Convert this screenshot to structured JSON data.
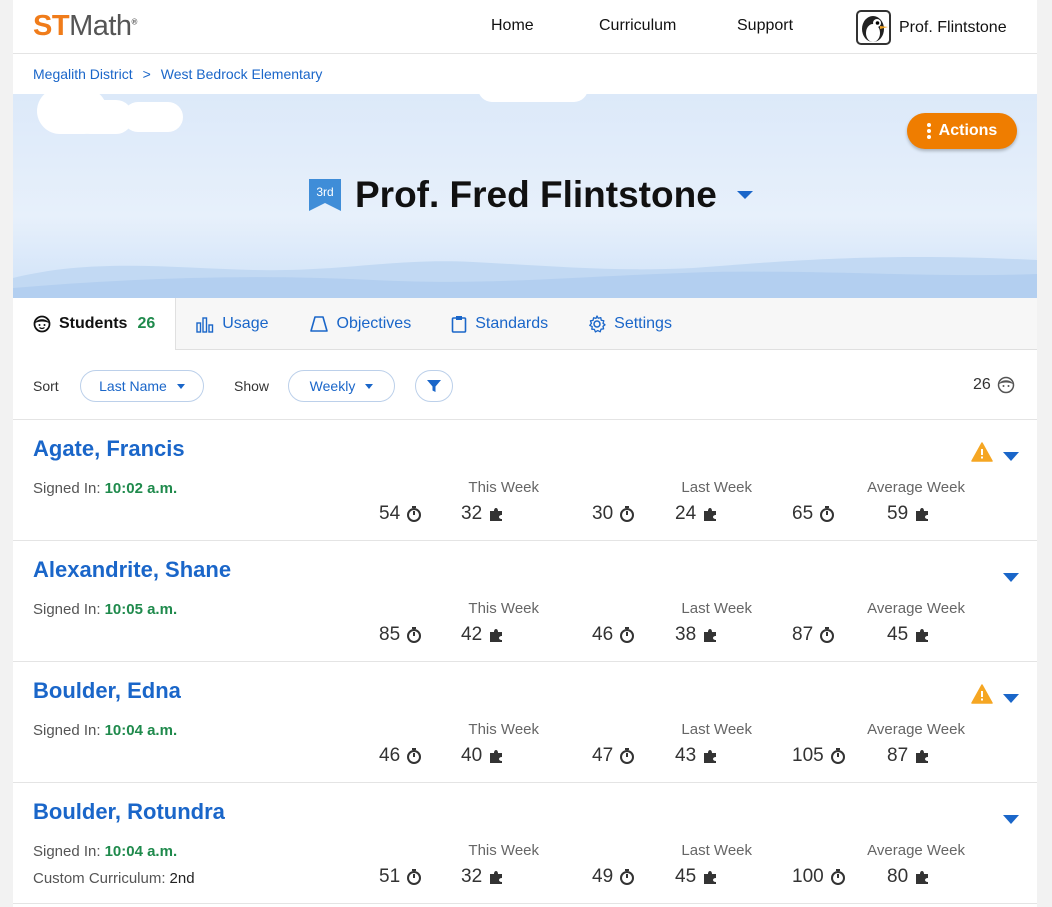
{
  "logo": {
    "st": "ST",
    "math": "Math"
  },
  "nav": {
    "home": "Home",
    "curriculum": "Curriculum",
    "support": "Support",
    "user_name": "Prof. Flintstone"
  },
  "breadcrumb": {
    "district": "Megalith District",
    "separator": ">",
    "school": "West Bedrock Elementary"
  },
  "hero": {
    "actions_label": "Actions",
    "grade_badge": "3rd",
    "teacher_name": "Prof. Fred Flintstone"
  },
  "tabs": [
    {
      "label": "Students",
      "count": "26",
      "icon": "student-face-icon"
    },
    {
      "label": "Usage",
      "icon": "bar-chart-icon"
    },
    {
      "label": "Objectives",
      "icon": "objectives-icon"
    },
    {
      "label": "Standards",
      "icon": "clipboard-icon"
    },
    {
      "label": "Settings",
      "icon": "gear-icon"
    }
  ],
  "toolbar": {
    "sort_label": "Sort",
    "sort_value": "Last Name",
    "show_label": "Show",
    "show_value": "Weekly",
    "student_count": "26"
  },
  "labels": {
    "signed_in": "Signed In:",
    "this_week": "This Week",
    "last_week": "Last Week",
    "average_week": "Average Week",
    "custom_curriculum": "Custom Curriculum:"
  },
  "students": [
    {
      "name": "Agate, Francis",
      "signed_in": "10:02 a.m.",
      "warning": true,
      "this_week": [
        "54",
        "32"
      ],
      "last_week": [
        "30",
        "24"
      ],
      "average_week": [
        "65",
        "59"
      ]
    },
    {
      "name": "Alexandrite, Shane",
      "signed_in": "10:05 a.m.",
      "warning": false,
      "this_week": [
        "85",
        "42"
      ],
      "last_week": [
        "46",
        "38"
      ],
      "average_week": [
        "87",
        "45"
      ]
    },
    {
      "name": "Boulder, Edna",
      "signed_in": "10:04 a.m.",
      "warning": true,
      "this_week": [
        "46",
        "40"
      ],
      "last_week": [
        "47",
        "43"
      ],
      "average_week": [
        "105",
        "87"
      ]
    },
    {
      "name": "Boulder, Rotundra",
      "signed_in": "10:04 a.m.",
      "warning": false,
      "custom_curriculum": "2nd",
      "this_week": [
        "51",
        "32"
      ],
      "last_week": [
        "49",
        "45"
      ],
      "average_week": [
        "100",
        "80"
      ]
    }
  ],
  "colors": {
    "accent": "#1a66c9",
    "orange": "#ef7d00",
    "green": "#1f8a4c",
    "warning": "#f5a623"
  }
}
